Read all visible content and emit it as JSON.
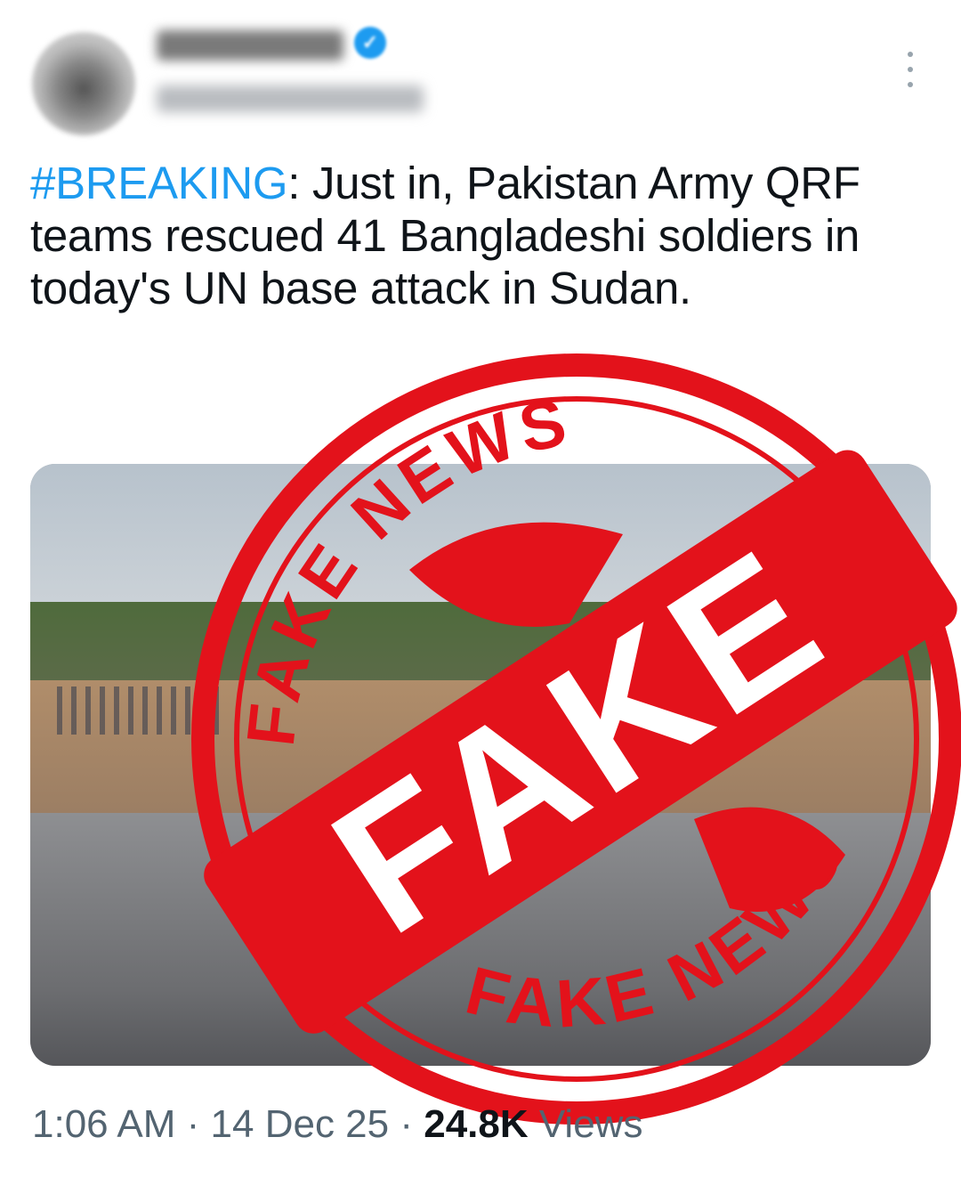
{
  "tweet": {
    "text_hashtag": "#BREAKING",
    "text_rest": ": Just in, Pakistan Army QRF teams rescued 41 Bangladeshi soldiers in today's UN base attack in Sudan.",
    "time": "1:06 AM",
    "separator": " · ",
    "date": "14 Dec 25",
    "views_count": "24.8K",
    "views_label": " Views"
  },
  "stamp": {
    "top_text": "FAKE NEWS",
    "center_text": "FAKE",
    "bottom_text": "FAKE NEWS",
    "color": "#e3121b"
  },
  "icons": {
    "verified": "verified-badge-icon",
    "more": "more-options-icon"
  },
  "colors": {
    "hashtag": "#1d9bf0",
    "text": "#0f1419",
    "meta": "#536471"
  }
}
